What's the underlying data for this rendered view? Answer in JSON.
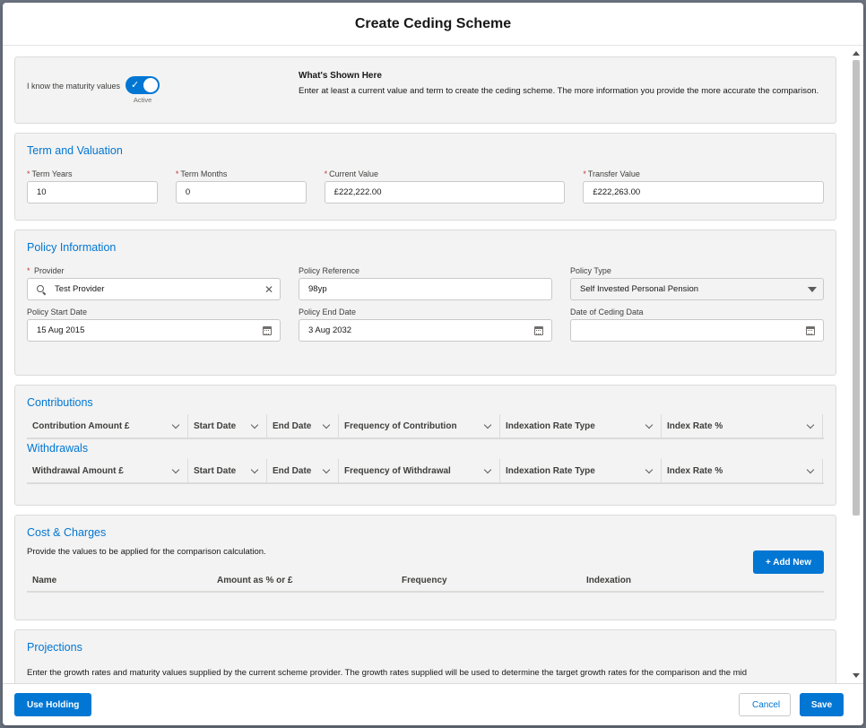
{
  "modal": {
    "title": "Create Ceding Scheme"
  },
  "top": {
    "toggle_label": "I know the maturity values",
    "toggle_state": "Active",
    "info_title": "What's Shown Here",
    "info_text": "Enter at least a current value and term to create the ceding scheme. The more information you provide the more accurate the comparison."
  },
  "term": {
    "title": "Term and Valuation",
    "fields": [
      {
        "label": "Term Years",
        "value": "10",
        "required": true
      },
      {
        "label": "Term Months",
        "value": "0",
        "required": true
      },
      {
        "label": "Current Value",
        "value": "£222,222.00",
        "required": true
      },
      {
        "label": "Transfer Value",
        "value": "£222,263.00",
        "required": true
      }
    ]
  },
  "policy": {
    "title": "Policy Information",
    "provider_label": "Provider",
    "provider_value": "Test Provider",
    "reference_label": "Policy Reference",
    "reference_value": "98yp",
    "type_label": "Policy Type",
    "type_value": "Self Invested Personal Pension",
    "start_label": "Policy Start Date",
    "start_value": "15 Aug 2015",
    "end_label": "Policy End Date",
    "end_value": "3 Aug 2032",
    "ceding_label": "Date of Ceding Data",
    "ceding_value": ""
  },
  "contributions": {
    "title": "Contributions",
    "columns": [
      "Contribution Amount £",
      "Start Date",
      "End Date",
      "Frequency of Contribution",
      "Indexation Rate Type",
      "Index Rate %"
    ]
  },
  "withdrawals": {
    "title": "Withdrawals",
    "columns": [
      "Withdrawal Amount £",
      "Start Date",
      "End Date",
      "Frequency of Withdrawal",
      "Indexation Rate Type",
      "Index Rate %"
    ]
  },
  "costs": {
    "title": "Cost & Charges",
    "description": "Provide the values to be applied for the comparison calculation.",
    "add_label": "+ Add New",
    "columns": [
      "Name",
      "Amount as % or £",
      "Frequency",
      "Indexation"
    ]
  },
  "projections": {
    "title": "Projections",
    "text": "Enter the growth rates and maturity values supplied by the current scheme provider. The growth rates supplied will be used to determine the target growth rates for the comparison and the mid"
  },
  "footer": {
    "use_holding": "Use Holding",
    "cancel": "Cancel",
    "save": "Save"
  },
  "colors": {
    "brand": "#0176d3",
    "required": "#c23934",
    "card_bg": "#f3f3f3"
  }
}
